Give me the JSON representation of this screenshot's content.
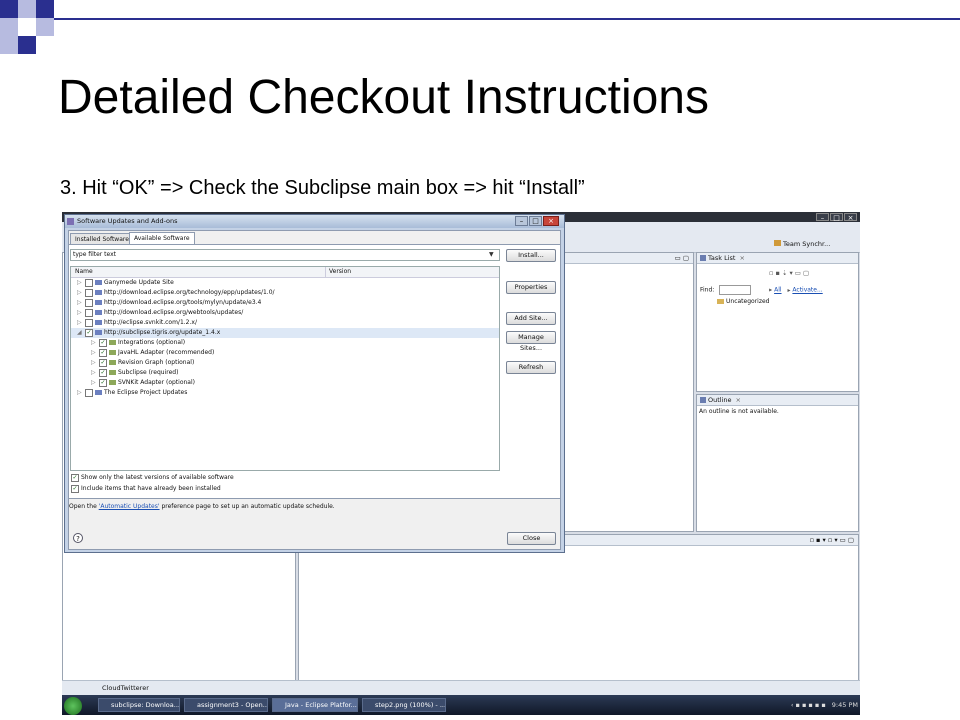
{
  "slide": {
    "title": "Detailed Checkout Instructions",
    "subtitle": "3. Hit “OK” => Check the Subclipse main box => hit “Install”",
    "accent_color": "#2a2f8f",
    "light_color": "#b7bbe0"
  },
  "dialog": {
    "title": "Software Updates and Add-ons",
    "tabs": [
      {
        "label": "Installed Software",
        "active": false
      },
      {
        "label": "Available Software",
        "active": true
      }
    ],
    "filter_placeholder": "type filter text",
    "columns": {
      "name": "Name",
      "version": "Version"
    },
    "tree": [
      {
        "label": "Ganymede Update Site",
        "level": 0,
        "checked": false,
        "kind": "site"
      },
      {
        "label": "http://download.eclipse.org/technology/epp/updates/1.0/",
        "level": 0,
        "checked": false,
        "kind": "site"
      },
      {
        "label": "http://download.eclipse.org/tools/mylyn/update/e3.4",
        "level": 0,
        "checked": false,
        "kind": "site"
      },
      {
        "label": "http://download.eclipse.org/webtools/updates/",
        "level": 0,
        "checked": false,
        "kind": "site"
      },
      {
        "label": "http://eclipse.svnkit.com/1.2.x/",
        "level": 0,
        "checked": false,
        "kind": "site"
      },
      {
        "label": "http://subclipse.tigris.org/update_1.4.x",
        "level": 0,
        "checked": true,
        "kind": "site",
        "selected": true,
        "expanded": true
      },
      {
        "label": "Integrations (optional)",
        "level": 1,
        "checked": true,
        "kind": "feature"
      },
      {
        "label": "JavaHL Adapter (recommended)",
        "level": 1,
        "checked": true,
        "kind": "feature"
      },
      {
        "label": "Revision Graph (optional)",
        "level": 1,
        "checked": true,
        "kind": "feature"
      },
      {
        "label": "Subclipse (required)",
        "level": 1,
        "checked": true,
        "kind": "feature"
      },
      {
        "label": "SVNKit Adapter (optional)",
        "level": 1,
        "checked": true,
        "kind": "feature"
      },
      {
        "label": "The Eclipse Project Updates",
        "level": 0,
        "checked": false,
        "kind": "site"
      }
    ],
    "buttons": {
      "install": "Install...",
      "properties": "Properties",
      "add_site": "Add Site...",
      "manage_sites": "Manage Sites...",
      "refresh": "Refresh",
      "close": "Close"
    },
    "options": {
      "latest_only": "Show only the latest versions of available software",
      "include_installed": "Include items that have already been installed"
    },
    "footer": {
      "prefix": "Open the ",
      "link": "'Automatic Updates'",
      "suffix": " preference page to set up an automatic update schedule."
    }
  },
  "eclipse": {
    "perspective_label": "Team Synchr...",
    "task_list": {
      "title": "Task List",
      "find_label": "Find:",
      "all_label": "All",
      "activate_label": "Activate...",
      "category": "Uncategorized"
    },
    "outline": {
      "title": "Outline",
      "message": "An outline is not available."
    },
    "status_item": "CloudTwitterer"
  },
  "taskbar": {
    "items": [
      "subclipse: Downloa...",
      "assignment3 - Open...",
      "Java - Eclipse Platfor...",
      "step2.png (100%) - ..."
    ],
    "clock": "9:45 PM"
  }
}
